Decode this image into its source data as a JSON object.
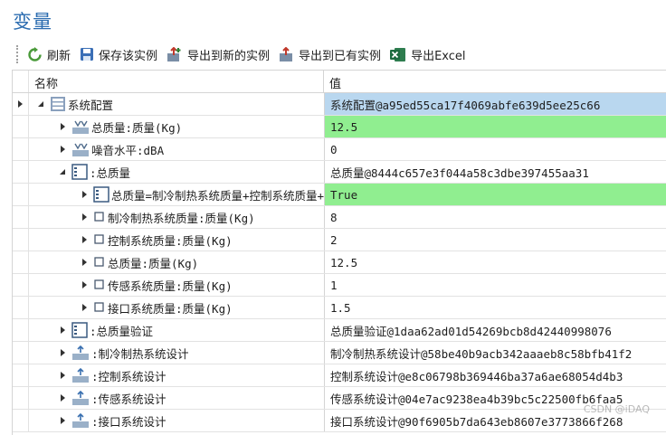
{
  "title": "变量",
  "toolbar": {
    "refresh": "刷新",
    "save_instance": "保存该实例",
    "export_new": "导出到新的实例",
    "export_existing": "导出到已有实例",
    "export_excel": "导出Excel"
  },
  "columns": {
    "name": "名称",
    "value": "值"
  },
  "rows": [
    {
      "label": "系统配置",
      "value": "系统配置@a95ed55ca17f4069abfe639d5ee25c66"
    },
    {
      "label": "总质量:质量(Kg)",
      "value": "12.5"
    },
    {
      "label": "噪音水平:dBA",
      "value": "0"
    },
    {
      "label": ":总质量",
      "value": "总质量@8444c657e3f044a58c3dbe397455aa31"
    },
    {
      "label": "总质量=制冷制热系统质量+控制系统质量+传感系统质量+接口系统质量",
      "value": "True"
    },
    {
      "label": "制冷制热系统质量:质量(Kg)",
      "value": "8"
    },
    {
      "label": "控制系统质量:质量(Kg)",
      "value": "2"
    },
    {
      "label": "总质量:质量(Kg)",
      "value": "12.5"
    },
    {
      "label": "传感系统质量:质量(Kg)",
      "value": "1"
    },
    {
      "label": "接口系统质量:质量(Kg)",
      "value": "1.5"
    },
    {
      "label": ":总质量验证",
      "value": "总质量验证@1daa62ad01d54269bcb8d42440998076"
    },
    {
      "label": ":制冷制热系统设计",
      "value": "制冷制热系统设计@58be40b9acb342aaaeb8c58bfb41f2"
    },
    {
      "label": ":控制系统设计",
      "value": "控制系统设计@e8c06798b369446ba37a6ae68054d4b3"
    },
    {
      "label": ":传感系统设计",
      "value": "传感系统设计@04e7ac9238ea4b39bc5c22500fb6faa5"
    },
    {
      "label": ":接口系统设计",
      "value": "接口系统设计@90f6905b7da643eb8607e3773866f268"
    }
  ],
  "watermark": "CSDN @iDAQ",
  "colors": {
    "selected": "#b9d7ef",
    "highlight": "#90ee90",
    "title": "#2b6cb0"
  }
}
